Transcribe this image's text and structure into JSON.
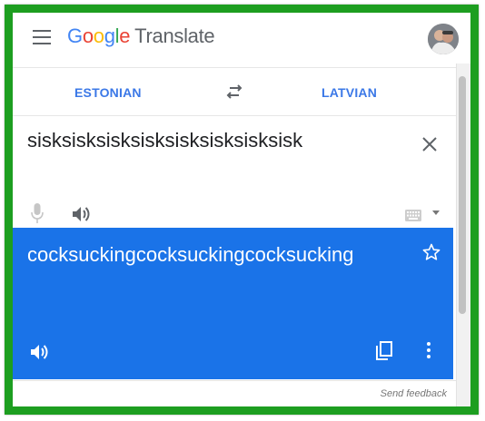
{
  "app": {
    "logo_letters": [
      "G",
      "o",
      "o",
      "g",
      "l",
      "e"
    ],
    "product_name": "Translate"
  },
  "languages": {
    "source": "ESTONIAN",
    "target": "LATVIAN"
  },
  "source": {
    "text": "sisksisksisksisksisksisksisksisk"
  },
  "translation": {
    "text": "cocksuckingcocksuckingcocksucking"
  },
  "footer": {
    "feedback_label": "Send feedback"
  },
  "colors": {
    "frame_border": "#1d9e20",
    "accent_blue": "#1a73e8",
    "lang_blue": "#3b78e7"
  },
  "icons": [
    "menu-icon",
    "avatar",
    "swap-icon",
    "close-icon",
    "microphone-icon",
    "speaker-icon",
    "keyboard-icon",
    "star-icon",
    "copy-icon",
    "more-vert-icon"
  ]
}
